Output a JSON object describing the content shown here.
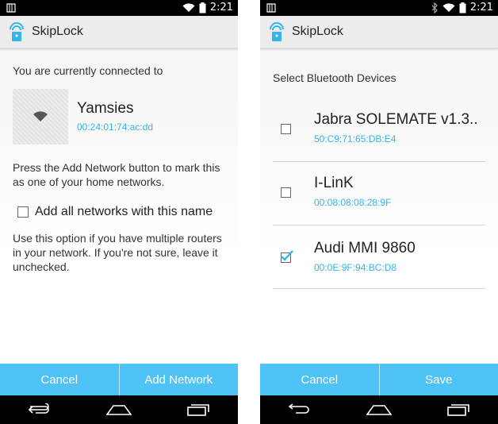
{
  "left": {
    "status": {
      "time": "2:21"
    },
    "app_title": "SkipLock",
    "connected_label": "You are currently connected to",
    "network": {
      "name": "Yamsies",
      "mac": "00:24:01:74:ac:dd"
    },
    "instruction": "Press the Add Network button to mark this as one of your home networks.",
    "checkbox_label": "Add all networks with this name",
    "checkbox_checked": false,
    "help_text": "Use this option if you have multiple routers in your network. If you're not sure, leave it unchecked.",
    "buttons": {
      "cancel": "Cancel",
      "confirm": "Add Network"
    }
  },
  "right": {
    "status": {
      "time": "2:21"
    },
    "app_title": "SkipLock",
    "heading": "Select Bluetooth Devices",
    "devices": [
      {
        "name": "Jabra SOLEMATE v1.3..",
        "mac": "50:C9:71:65:DB:E4",
        "checked": false
      },
      {
        "name": "I-LinK",
        "mac": "00:08:08:08:28:9F",
        "checked": false
      },
      {
        "name": "Audi MMI 9860",
        "mac": "00:0E:9F:94:BC:D8",
        "checked": true
      }
    ],
    "buttons": {
      "cancel": "Cancel",
      "confirm": "Save"
    }
  },
  "colors": {
    "accent": "#4fc3f7",
    "mac_text": "#33b5e5"
  }
}
